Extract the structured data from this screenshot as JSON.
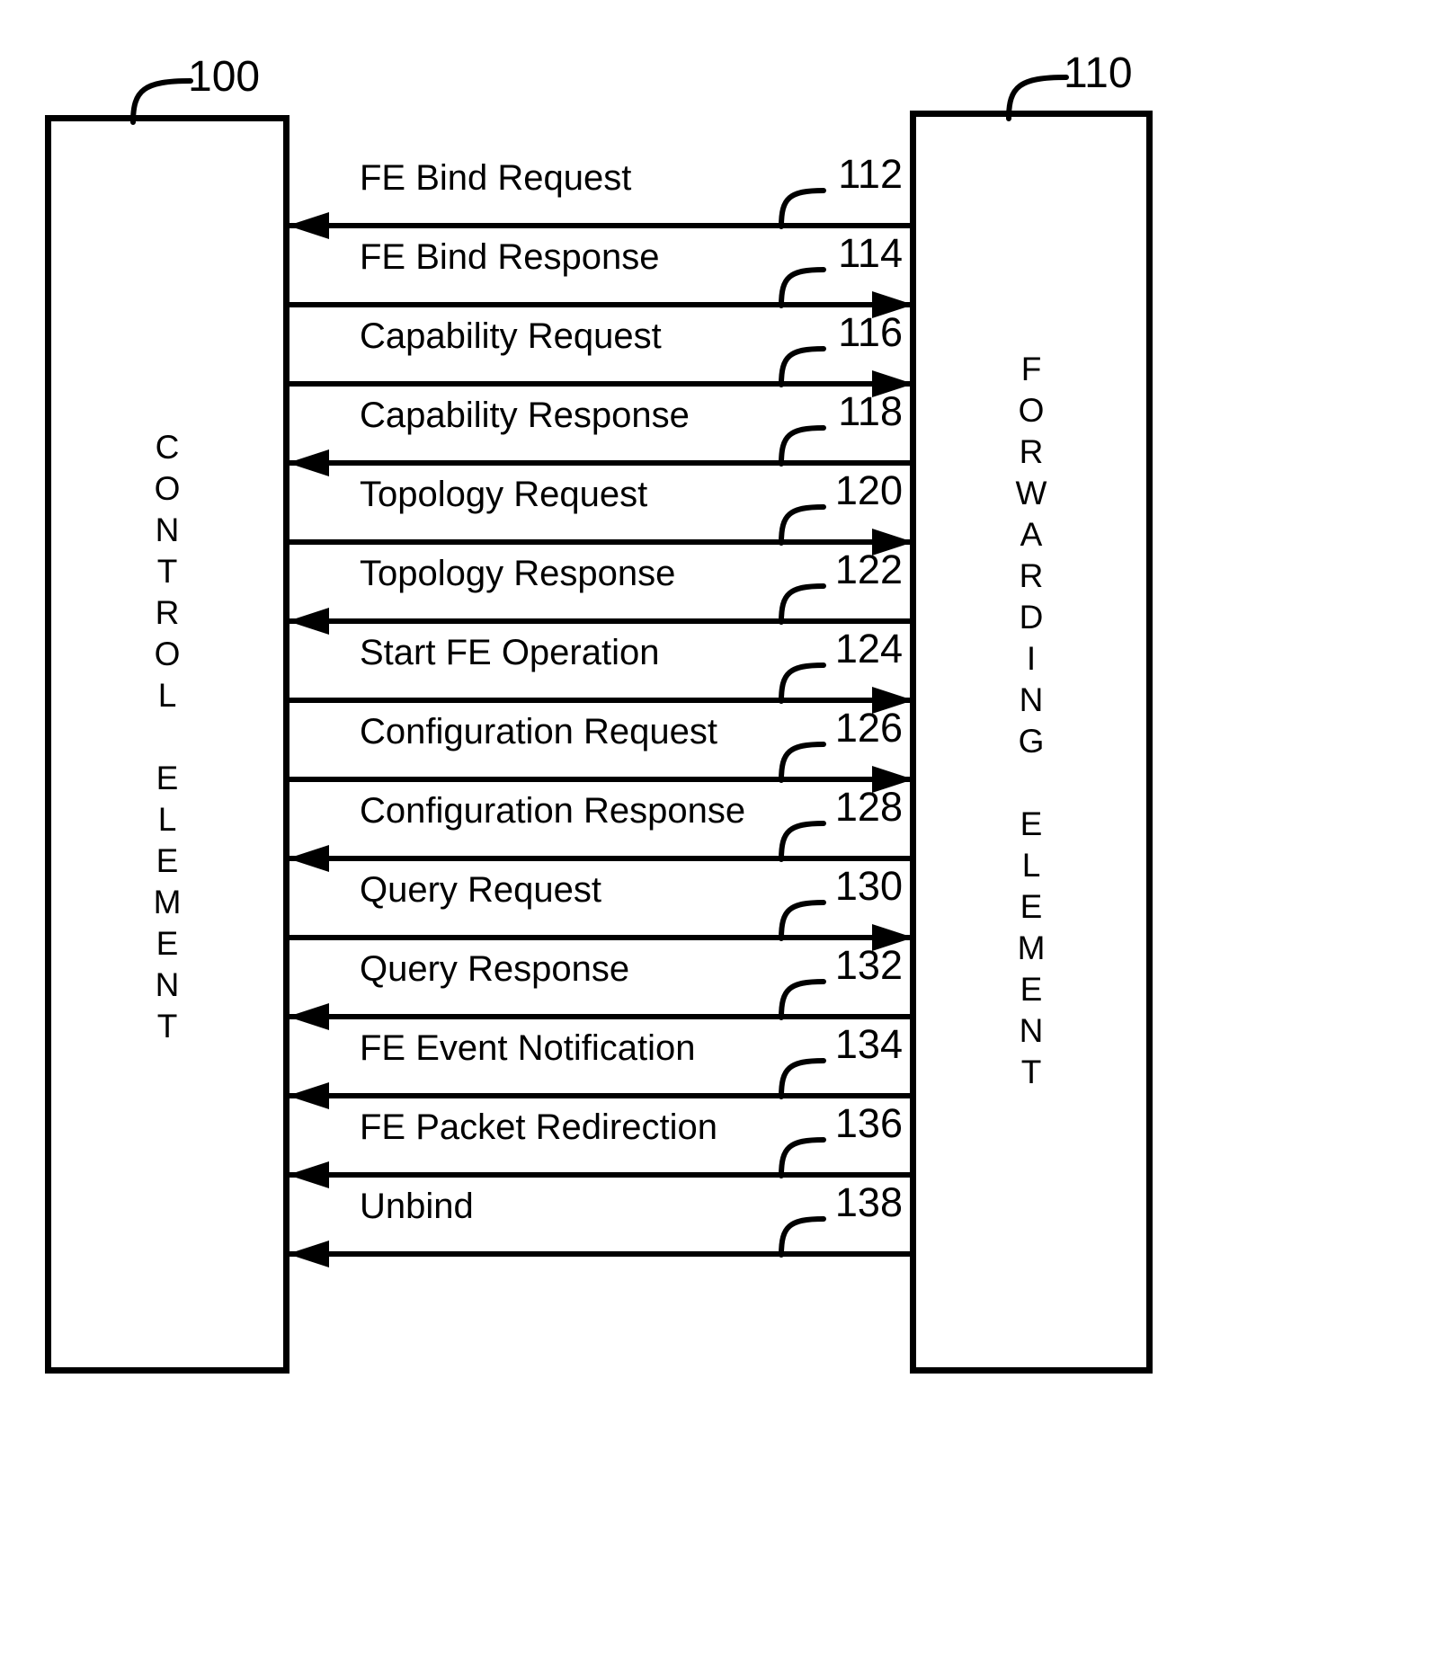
{
  "figure": {
    "type": "sequence-diagram",
    "background_color": "#ffffff",
    "line_color": "#000000"
  },
  "endpoints": {
    "left": {
      "label": "CONTROL ELEMENT",
      "label_lines": [
        "C",
        "O",
        "N",
        "T",
        "R",
        "O",
        "L",
        "",
        "E",
        "L",
        "E",
        "M",
        "E",
        "N",
        "T"
      ],
      "ref": "100"
    },
    "right": {
      "label": "FORWARDING ELEMENT",
      "label_lines": [
        "F",
        "O",
        "R",
        "W",
        "A",
        "R",
        "D",
        "I",
        "N",
        "G",
        "",
        "E",
        "L",
        "E",
        "M",
        "E",
        "N",
        "T"
      ],
      "ref": "110"
    }
  },
  "messages": [
    {
      "label": "FE Bind Request",
      "ref": "112",
      "direction": "left"
    },
    {
      "label": "FE Bind Response",
      "ref": "114",
      "direction": "right"
    },
    {
      "label": "Capability Request",
      "ref": "116",
      "direction": "right"
    },
    {
      "label": "Capability Response",
      "ref": "118",
      "direction": "left"
    },
    {
      "label": "Topology Request",
      "ref": "120",
      "direction": "right"
    },
    {
      "label": "Topology Response",
      "ref": "122",
      "direction": "left"
    },
    {
      "label": "Start FE Operation",
      "ref": "124",
      "direction": "right"
    },
    {
      "label": "Configuration Request",
      "ref": "126",
      "direction": "right"
    },
    {
      "label": "Configuration Response",
      "ref": "128",
      "direction": "left"
    },
    {
      "label": "Query Request",
      "ref": "130",
      "direction": "right"
    },
    {
      "label": "Query Response",
      "ref": "132",
      "direction": "left"
    },
    {
      "label": "FE Event Notification",
      "ref": "134",
      "direction": "left"
    },
    {
      "label": "FE Packet Redirection",
      "ref": "136",
      "direction": "left"
    },
    {
      "label": "Unbind",
      "ref": "138",
      "direction": "left"
    }
  ]
}
